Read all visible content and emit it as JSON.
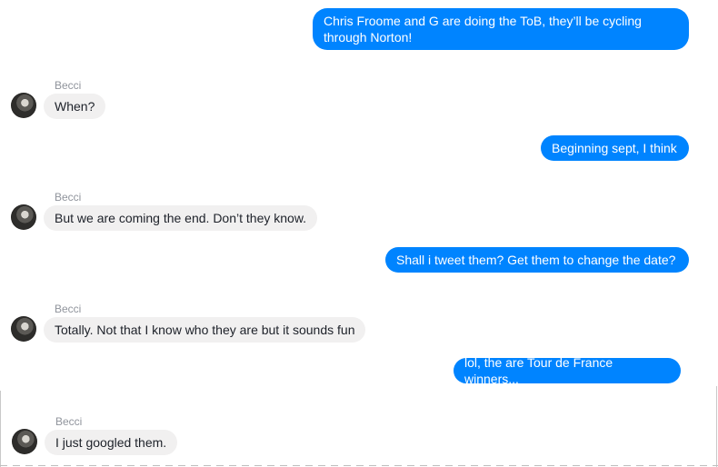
{
  "messages": [
    {
      "direction": "outgoing",
      "text": "Chris Froome and G are doing the ToB, they’ll be cycling through Norton!"
    },
    {
      "direction": "incoming",
      "sender": "Becci",
      "text": "When?"
    },
    {
      "direction": "outgoing",
      "text": "Beginning sept, I think"
    },
    {
      "direction": "incoming",
      "sender": "Becci",
      "text": "But we are coming the end. Don’t they know."
    },
    {
      "direction": "outgoing",
      "text": "Shall i tweet them? Get them to change the date?"
    },
    {
      "direction": "incoming",
      "sender": "Becci",
      "text": "Totally. Not that I know who they are but it sounds fun"
    },
    {
      "direction": "outgoing",
      "text": "lol, the are Tour de France winners..."
    },
    {
      "direction": "incoming",
      "sender": "Becci",
      "text": "I just googled them."
    }
  ],
  "colors": {
    "outgoing_bubble": "#0084ff",
    "incoming_bubble": "#f1f0f0",
    "sender_name": "#90949c"
  }
}
